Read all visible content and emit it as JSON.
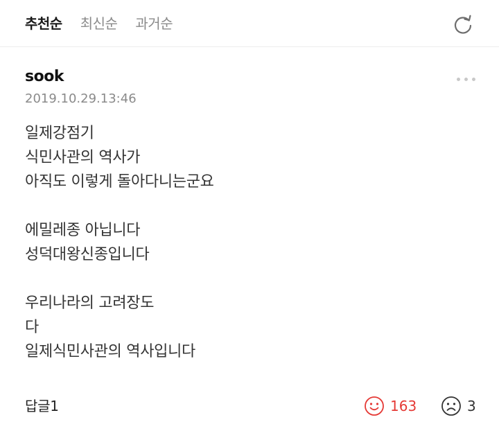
{
  "sort": {
    "tabs": [
      {
        "label": "추천순"
      },
      {
        "label": "최신순"
      },
      {
        "label": "과거순"
      }
    ],
    "active_index": 0,
    "refresh_icon": "refresh-icon"
  },
  "comment": {
    "author": "sook",
    "timestamp": "2019.10.29.13:46",
    "more_icon": "more-dots-icon",
    "lines": [
      "일제강점기",
      "식민사관의 역사가",
      "아직도 이렇게 돌아다니는군요",
      "",
      "에밀레종 아닙니다",
      "성덕대왕신종입니다",
      "",
      "우리나라의 고려장도",
      "다",
      "일제식민사관의 역사입니다"
    ],
    "reply_label": "답글1",
    "likes": "163",
    "dislikes": "3",
    "like_icon": "smile-icon",
    "dislike_icon": "frown-icon",
    "colors": {
      "like": "#e53935",
      "neutral": "#333333",
      "muted": "#8a8a8a"
    }
  }
}
